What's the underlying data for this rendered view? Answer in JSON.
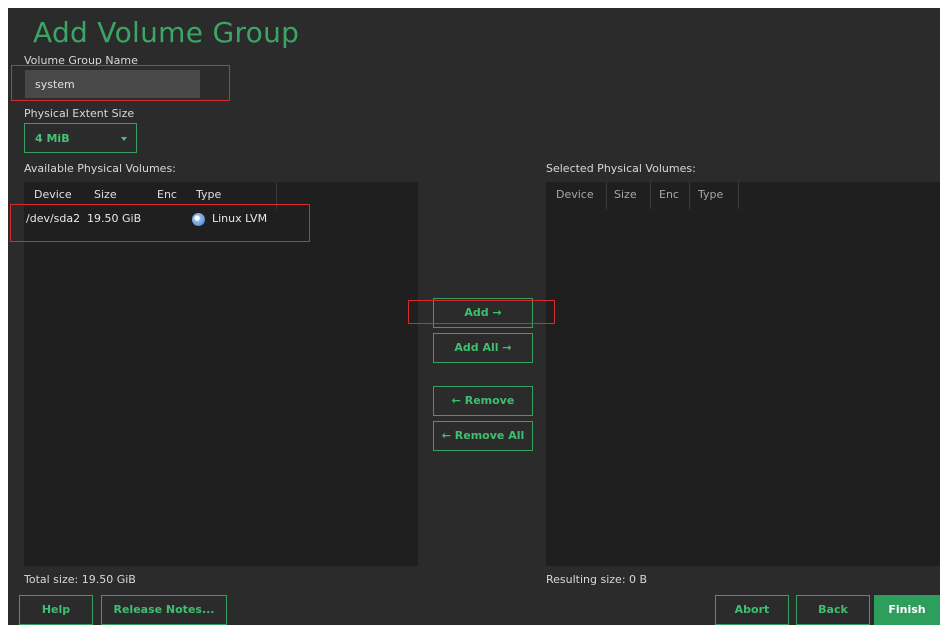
{
  "dialog": {
    "title": "Add Volume Group"
  },
  "vg_name": {
    "label": "Volume Group Name",
    "value": "system"
  },
  "extent": {
    "label": "Physical Extent Size",
    "value": "4 MiB"
  },
  "available": {
    "label": "Available Physical Volumes:",
    "columns": [
      "Device",
      "Size",
      "Enc",
      "Type"
    ],
    "rows": [
      {
        "device": "/dev/sda2",
        "size": "19.50 GiB",
        "enc": "",
        "type": "Linux LVM",
        "icon": "disk-icon"
      }
    ],
    "total": "Total size: 19.50 GiB"
  },
  "selected": {
    "label": "Selected Physical Volumes:",
    "columns": [
      "Device",
      "Size",
      "Enc",
      "Type"
    ],
    "result": "Resulting size: 0 B"
  },
  "actions": {
    "add": "Add →",
    "add_all": "Add All →",
    "remove": "← Remove",
    "remove_all": "← Remove All"
  },
  "footer": {
    "help": "Help",
    "release_notes": "Release Notes...",
    "abort": "Abort",
    "back": "Back",
    "finish": "Finish"
  },
  "colors": {
    "accent": "#3ba565",
    "highlight_box": "#d82b2b",
    "background": "#2b2b2b",
    "panel": "#1f1f1f"
  }
}
